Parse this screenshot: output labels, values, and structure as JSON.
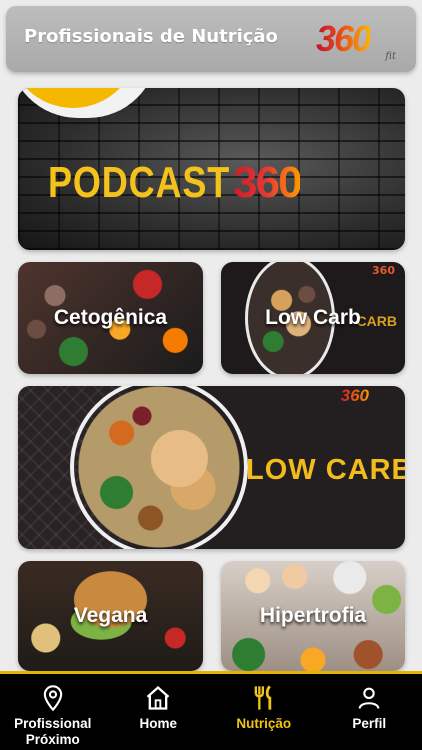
{
  "header": {
    "title": "Profissionais de Nutrição",
    "brand": {
      "number": "360",
      "suffix": "fit"
    }
  },
  "podcast": {
    "text": "PODCAST",
    "number": "360"
  },
  "cards": [
    {
      "label": "Cetogênica"
    },
    {
      "label": "Low Carb",
      "side_text": "CARB",
      "side_number": "360"
    },
    {
      "text": "LOW CARB",
      "number": "360"
    },
    {
      "label": "Vegana"
    },
    {
      "label": "Hipertrofia"
    }
  ],
  "nav": {
    "items": [
      {
        "label": "Profissional Próximo",
        "icon": "location-pin-icon"
      },
      {
        "label": "Home",
        "icon": "home-icon"
      },
      {
        "label": "Nutrição",
        "icon": "fork-knife-icon",
        "active": true
      },
      {
        "label": "Perfil",
        "icon": "person-icon"
      }
    ],
    "accent": "#f0c419"
  }
}
